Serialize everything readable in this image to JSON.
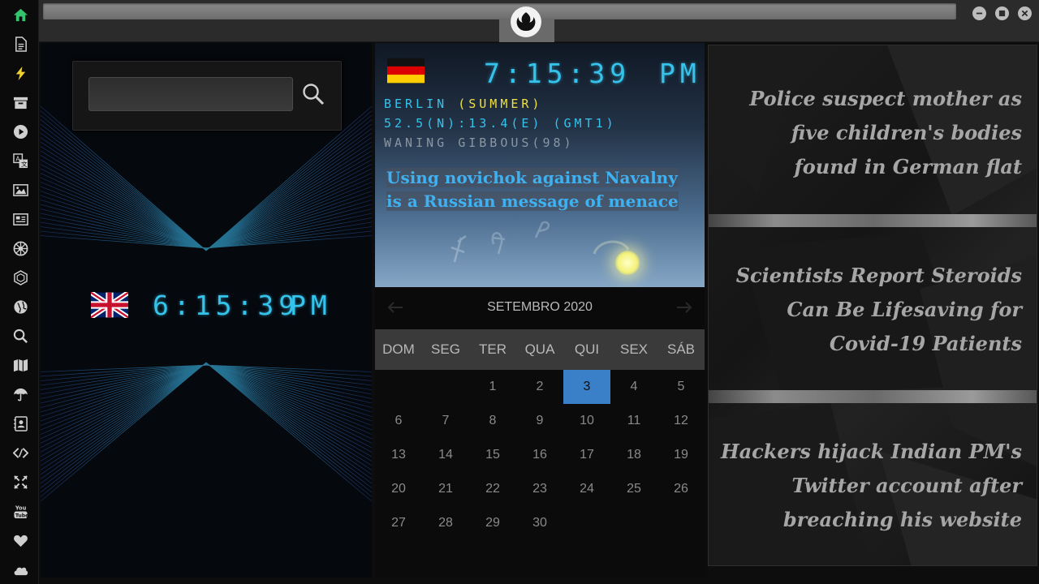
{
  "sidebar": {
    "items": [
      {
        "icon": "home-icon",
        "color": "#35c46e"
      },
      {
        "icon": "document-icon",
        "color": "#cfcfcf"
      },
      {
        "icon": "lightning-icon",
        "color": "#f2d230"
      },
      {
        "icon": "archive-icon",
        "color": "#cfcfcf"
      },
      {
        "icon": "play-icon",
        "color": "#cfcfcf"
      },
      {
        "icon": "translate-icon",
        "color": "#cfcfcf"
      },
      {
        "icon": "image-icon",
        "color": "#cfcfcf"
      },
      {
        "icon": "newspaper-icon",
        "color": "#cfcfcf"
      },
      {
        "icon": "galactic-empire-icon",
        "color": "#cfcfcf"
      },
      {
        "icon": "hexagon-icon",
        "color": "#cfcfcf"
      },
      {
        "icon": "globe-icon",
        "color": "#cfcfcf"
      },
      {
        "icon": "search-icon",
        "color": "#cfcfcf"
      },
      {
        "icon": "map-icon",
        "color": "#cfcfcf"
      },
      {
        "icon": "umbrella-icon",
        "color": "#cfcfcf"
      },
      {
        "icon": "contacts-icon",
        "color": "#cfcfcf"
      },
      {
        "icon": "code-icon",
        "color": "#cfcfcf"
      },
      {
        "icon": "expand-icon",
        "color": "#cfcfcf"
      },
      {
        "icon": "youtube-icon",
        "color": "#cfcfcf"
      },
      {
        "icon": "heart-icon",
        "color": "#cfcfcf"
      },
      {
        "icon": "cloud-icon",
        "color": "#cfcfcf"
      }
    ]
  },
  "window": {
    "logo_icon": "rebel-alliance-icon",
    "controls": [
      "minimize-icon",
      "maximize-icon",
      "close-icon"
    ]
  },
  "search": {
    "value": "",
    "placeholder": ""
  },
  "uk_clock": {
    "flag_icon": "uk-flag-icon",
    "time": "6:15:39",
    "ampm": "PM"
  },
  "de_clock": {
    "flag_icon": "germany-flag-icon",
    "time": "7:15:39",
    "ampm": "PM",
    "city_prefix": "BERLIN ",
    "city_season": "(SUMMER)",
    "coords": "52.5(N):13.4(E) (GMT1)",
    "moon": "WANING GIBBOUS(98)",
    "headline": "Using novichok against Navalny is a Russian message of menace"
  },
  "calendar": {
    "title": "SETEMBRO 2020",
    "weekdays": [
      "DOM",
      "SEG",
      "TER",
      "QUA",
      "QUI",
      "SEX",
      "SÁB"
    ],
    "weeks": [
      [
        "",
        "",
        "1",
        "2",
        "3",
        "4",
        "5"
      ],
      [
        "6",
        "7",
        "8",
        "9",
        "10",
        "11",
        "12"
      ],
      [
        "13",
        "14",
        "15",
        "16",
        "17",
        "18",
        "19"
      ],
      [
        "20",
        "21",
        "22",
        "23",
        "24",
        "25",
        "26"
      ],
      [
        "27",
        "28",
        "29",
        "30",
        "",
        "",
        ""
      ]
    ],
    "today": "3",
    "today_color": "#3a80c8"
  },
  "news": [
    "Police suspect mother as five children's bodies found in German flat",
    "Scientists Report Steroids Can Be Lifesaving for Covid-19 Patients",
    "Hackers hijack Indian PM's Twitter account after breaching his website"
  ],
  "colors": {
    "digital": "#35c3ec",
    "season_highlight": "#f0e040",
    "headline": "#3fb0f0"
  }
}
